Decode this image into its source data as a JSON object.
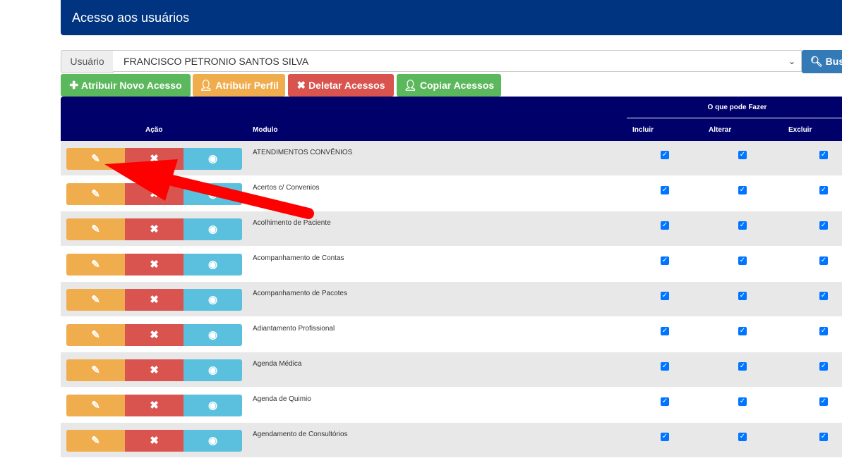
{
  "header": {
    "title": "Acesso aos usuários"
  },
  "user_filter": {
    "label": "Usuário",
    "selected": "FRANCISCO PETRONIO SANTOS SILVA",
    "search_label": "Bus"
  },
  "actions": {
    "assign_new": "Atribuir Novo Acesso",
    "assign_profile": "Atribuir Perfil",
    "delete": "Deletar Acessos",
    "copy": "Copiar Acessos"
  },
  "table": {
    "group_header": "O que pode Fazer",
    "headers": {
      "action": "Ação",
      "module": "Modulo",
      "include": "Incluir",
      "edit": "Alterar",
      "delete": "Excluir"
    },
    "rows": [
      {
        "module": "ATENDIMENTOS CONVÊNIOS",
        "include": true,
        "edit": true,
        "delete": true
      },
      {
        "module": "Acertos c/ Convenios",
        "include": true,
        "edit": true,
        "delete": true
      },
      {
        "module": "Acolhimento de Paciente",
        "include": true,
        "edit": true,
        "delete": true
      },
      {
        "module": "Acompanhamento de Contas",
        "include": true,
        "edit": true,
        "delete": true
      },
      {
        "module": "Acompanhamento de Pacotes",
        "include": true,
        "edit": true,
        "delete": true
      },
      {
        "module": "Adiantamento Profissional",
        "include": true,
        "edit": true,
        "delete": true
      },
      {
        "module": "Agenda Médica",
        "include": true,
        "edit": true,
        "delete": true
      },
      {
        "module": "Agenda de Quimio",
        "include": true,
        "edit": true,
        "delete": true
      },
      {
        "module": "Agendamento de Consultórios",
        "include": true,
        "edit": true,
        "delete": true
      }
    ]
  },
  "colors": {
    "header": "#003380",
    "table_header": "#00006b",
    "annotation_arrow": "#ff0000"
  }
}
